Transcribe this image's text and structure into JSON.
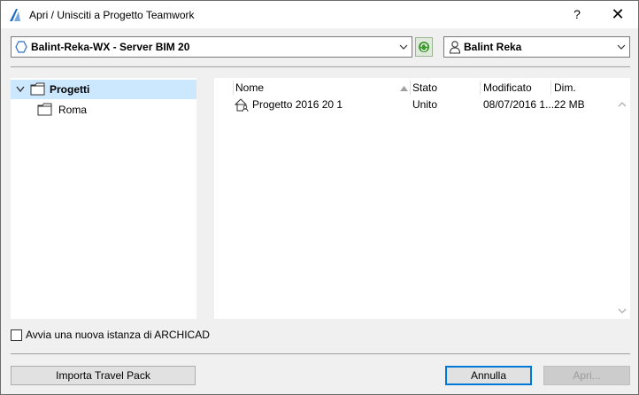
{
  "window": {
    "title": "Apri / Unisciti a Progetto Teamwork",
    "help_label": "?",
    "close_label": "✕"
  },
  "toolbar": {
    "server": {
      "label": "Balint-Reka-WX - Server BIM 20"
    },
    "user": {
      "label": "Balint Reka"
    }
  },
  "tree": {
    "items": [
      {
        "label": "Progetti",
        "selected": true,
        "expanded": true
      },
      {
        "label": "Roma"
      }
    ]
  },
  "file_list": {
    "columns": [
      "Nome",
      "Stato",
      "Modificato",
      "Dim."
    ],
    "rows": [
      {
        "name": "Progetto 2016 20 1",
        "status": "Unito",
        "modified": "08/07/2016 1...",
        "size": "22 MB"
      }
    ]
  },
  "options": {
    "new_instance_label": "Avvia una nuova istanza di ARCHICAD",
    "new_instance_checked": false
  },
  "buttons": {
    "import_label": "Importa Travel Pack",
    "cancel_label": "Annulla",
    "open_label": "Apri..."
  },
  "colors": {
    "selection": "#cce8ff",
    "accent": "#0078d7",
    "refresh": "#3a9a2a"
  }
}
